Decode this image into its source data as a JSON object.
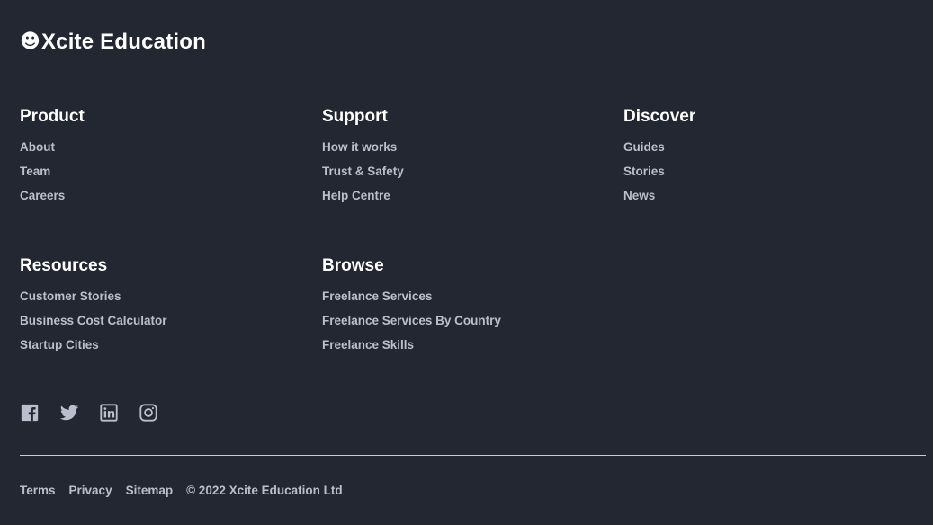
{
  "brand": {
    "icon": "☻",
    "name": "Xcite Education"
  },
  "columns": [
    {
      "heading": "Product",
      "links": [
        "About",
        "Team",
        "Careers"
      ]
    },
    {
      "heading": "Support",
      "links": [
        "How it works",
        "Trust & Safety",
        "Help Centre"
      ]
    },
    {
      "heading": "Discover",
      "links": [
        "Guides",
        "Stories",
        "News"
      ]
    },
    {
      "heading": "Resources",
      "links": [
        "Customer Stories",
        "Business Cost Calculator",
        "Startup Cities"
      ]
    },
    {
      "heading": "Browse",
      "links": [
        "Freelance Services",
        "Freelance Services By Country",
        "Freelance Skills"
      ]
    }
  ],
  "social": [
    "facebook-icon",
    "twitter-icon",
    "linkedin-icon",
    "instagram-icon"
  ],
  "bottom": {
    "terms": "Terms",
    "privacy": "Privacy",
    "sitemap": "Sitemap",
    "copyright": "© 2022 Xcite Education Ltd"
  },
  "colors": {
    "background": "#222731",
    "heading": "#ffffff",
    "link": "#b9bfcc",
    "divider": "#c9ccd3"
  }
}
